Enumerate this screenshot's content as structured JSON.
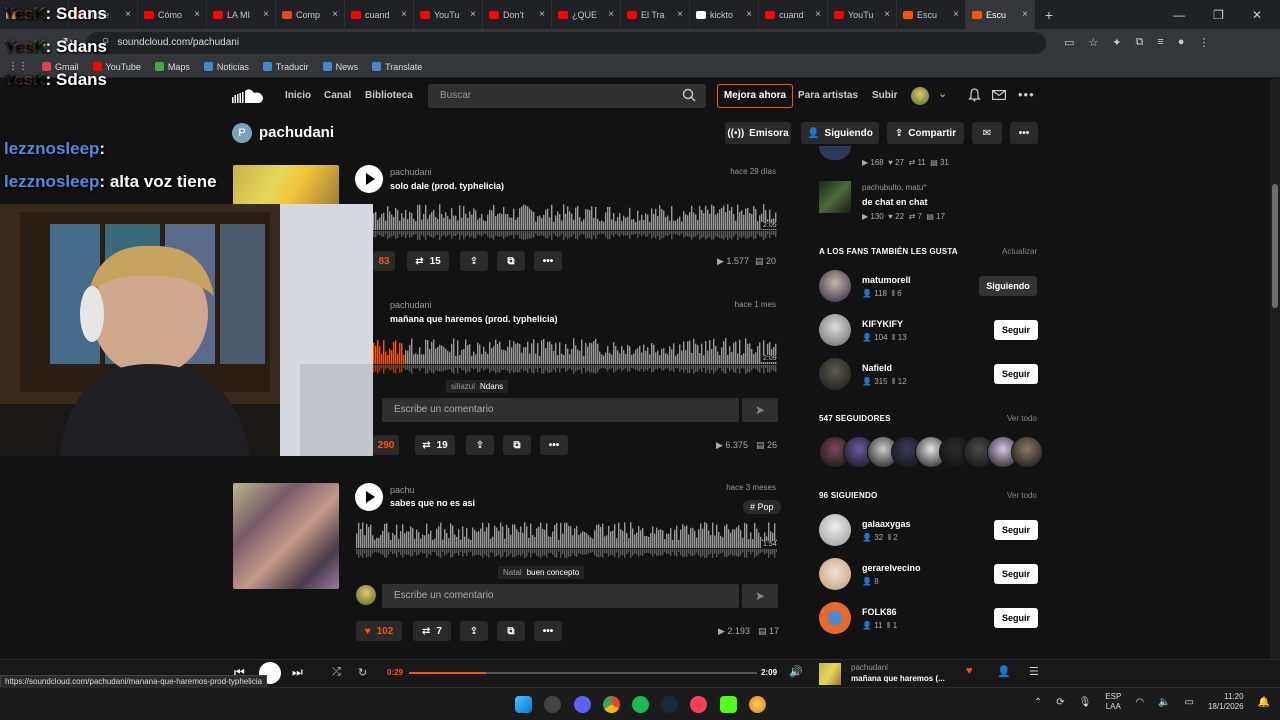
{
  "browser": {
    "tabs": [
      {
        "title": "",
        "color": "#d9b25a"
      },
      {
        "title": "mate",
        "color": "#ff0000"
      },
      {
        "title": "Cómo",
        "color": "#ff0000"
      },
      {
        "title": "LA MI",
        "color": "#ff0000"
      },
      {
        "title": "Comp",
        "color": "#e04a2a"
      },
      {
        "title": "cuand",
        "color": "#ff0000"
      },
      {
        "title": "YouTu",
        "color": "#ff0000"
      },
      {
        "title": "Don't",
        "color": "#ff0000"
      },
      {
        "title": "¿QUE",
        "color": "#ff0000"
      },
      {
        "title": "El Tra",
        "color": "#ff0000"
      },
      {
        "title": "kickto",
        "color": "#ffffff"
      },
      {
        "title": "cuand",
        "color": "#ff0000"
      },
      {
        "title": "YouTu",
        "color": "#ff0000"
      },
      {
        "title": "Escu",
        "color": "#ff5500"
      },
      {
        "title": "Escu",
        "color": "#ff5500",
        "active": true
      }
    ],
    "url": "soundcloud.com/pachudani",
    "bookmarks": [
      {
        "label": "Gmail",
        "color": "#d44"
      },
      {
        "label": "YouTube",
        "color": "#f00"
      },
      {
        "label": "Maps",
        "color": "#4a4"
      },
      {
        "label": "Noticias",
        "color": "#48c"
      },
      {
        "label": "Traducir",
        "color": "#48c"
      },
      {
        "label": "News",
        "color": "#48c"
      },
      {
        "label": "Translate",
        "color": "#48c"
      }
    ]
  },
  "sc_nav": {
    "home": "Inicio",
    "feed": "Canal",
    "library": "Biblioteca",
    "search_placeholder": "Buscar",
    "upgrade": "Mejora ahora",
    "artists": "Para artistas",
    "upload": "Subir"
  },
  "profile": {
    "initial": "P",
    "name": "pachudani",
    "btn_station": "Emisora",
    "btn_following": "Siguiendo",
    "btn_share": "Compartir"
  },
  "tracks": [
    {
      "artist": "pachudani",
      "title": "solo dale (prod. typhelicia)",
      "date": "hace 29 días",
      "duration": "2:05",
      "likes": "83",
      "reposts": "15",
      "plays": "1.577",
      "comments": "20"
    },
    {
      "artist": "pachudani",
      "title": "mañana que haremos (prod. typhelicia)",
      "date": "hace 1 mes",
      "duration": "2:09",
      "comment_user": "sillazul",
      "comment_text": "Ndans",
      "comment_placeholder": "Escribe un comentario",
      "likes": "290",
      "reposts": "19",
      "plays": "6.375",
      "comments": "26"
    },
    {
      "artist": "pachu",
      "title": "sabes que no es asi",
      "date": "hace 3 meses",
      "duration": "1:54",
      "tag": "# Pop",
      "comment_user": "Natal",
      "comment_text": "buen concepto",
      "comment_placeholder": "Escribe un comentario",
      "likes": "102",
      "reposts": "7",
      "plays": "2.193",
      "comments": "17"
    }
  ],
  "sidebar": {
    "top_item": {
      "plays": "168",
      "likes": "27",
      "reposts": "11",
      "comments": "31"
    },
    "second_item": {
      "artist": "pachubulto, matu*",
      "title": "de chat en chat",
      "plays": "130",
      "likes": "22",
      "reposts": "7",
      "comments": "17"
    },
    "fans_like_title": "A LOS FANS TAMBIÉN LES GUSTA",
    "fans_like_action": "Actualizar",
    "suggested": [
      {
        "name": "matumorell",
        "followers": "118",
        "tracks": "6",
        "button": "Siguiendo"
      },
      {
        "name": "KIFYKIFY",
        "followers": "104",
        "tracks": "13",
        "button": "Seguir"
      },
      {
        "name": "Nafield",
        "followers": "315",
        "tracks": "12",
        "button": "Seguir"
      }
    ],
    "followers_title": "547 SEGUIDORES",
    "followers_link": "Ver todo",
    "following_title": "96 SIGUIENDO",
    "following_link": "Ver todo",
    "following": [
      {
        "name": "galaaxygas",
        "followers": "32",
        "tracks": "2",
        "button": "Seguir"
      },
      {
        "name": "gerarelvecino",
        "followers": "8",
        "button": "Seguir"
      },
      {
        "name": "FOLK86",
        "followers": "11",
        "tracks": "1",
        "button": "Seguir"
      }
    ]
  },
  "player": {
    "current_time": "0:29",
    "total_time": "2:09",
    "progress": 0.22,
    "artist": "pachudani",
    "title": "mañana que haremos (..."
  },
  "status_url": "https://soundcloud.com/pachudani/manana-que-haremos-prod-typhelicia",
  "stream_chat": [
    {
      "user": "YesK",
      "msg": "Sdans"
    },
    {
      "user": "YesK",
      "msg": "Sdans"
    },
    {
      "user": "YesK",
      "msg": "Sdans"
    },
    {
      "user": "lezznosleep",
      "msg": ""
    },
    {
      "user": "lezznosleep",
      "msg": "alta voz tiene"
    }
  ],
  "tray": {
    "lang1": "ESP",
    "lang2": "LAA",
    "time": "11:20",
    "date": "18/1/2026"
  }
}
